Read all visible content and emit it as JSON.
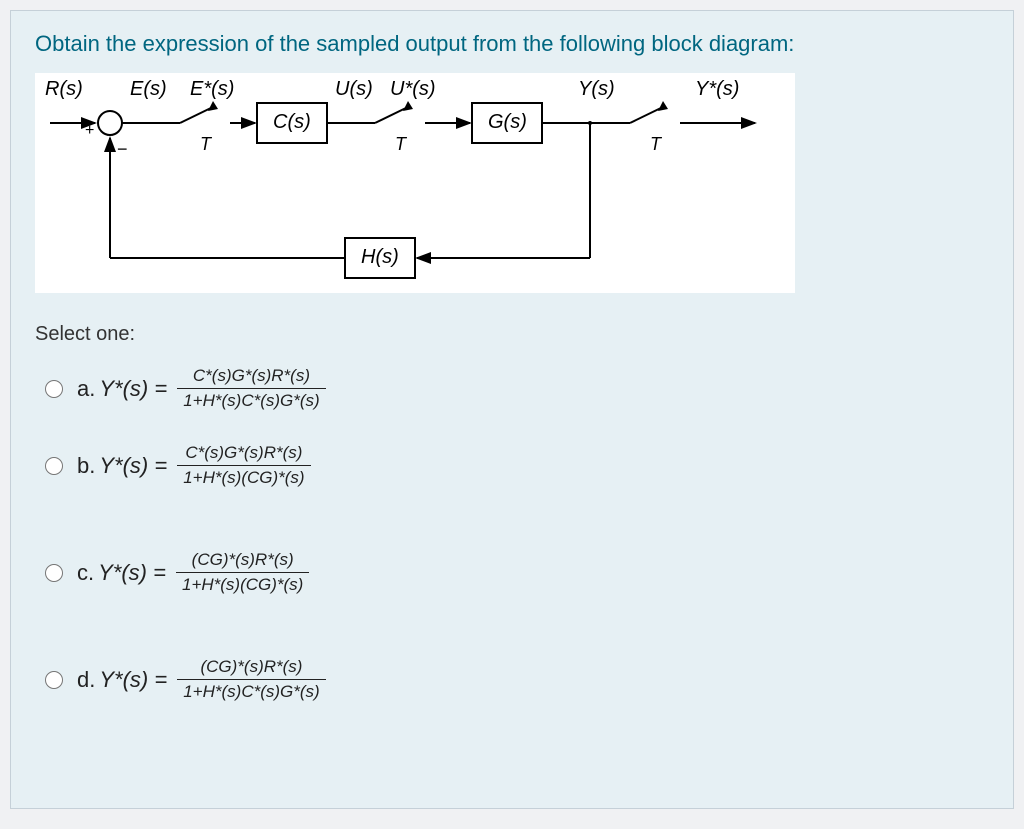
{
  "question": {
    "prompt": "Obtain the expression of the sampled output from the following block diagram:",
    "select_label": "Select one:"
  },
  "diagram": {
    "signals": {
      "R": "R(s)",
      "E": "E(s)",
      "Estar": "E*(s)",
      "U": "U(s)",
      "Ustar": "U*(s)",
      "Y": "Y(s)",
      "Ystar": "Y*(s)"
    },
    "blocks": {
      "C": "C(s)",
      "G": "G(s)",
      "H": "H(s)"
    },
    "sampler_label": "T",
    "summer": {
      "plus": "+",
      "minus": "−"
    }
  },
  "options": {
    "a": {
      "letter": "a.",
      "lhs": "Y*(s) =",
      "num": "C*(s)G*(s)R*(s)",
      "den": "1+H*(s)C*(s)G*(s)"
    },
    "b": {
      "letter": "b.",
      "lhs": "Y*(s) =",
      "num": "C*(s)G*(s)R*(s)",
      "den": "1+H*(s)(CG)*(s)"
    },
    "c": {
      "letter": "c.",
      "lhs": "Y*(s) =",
      "num": "(CG)*(s)R*(s)",
      "den": "1+H*(s)(CG)*(s)"
    },
    "d": {
      "letter": "d.",
      "lhs": "Y*(s) =",
      "num": "(CG)*(s)R*(s)",
      "den": "1+H*(s)C*(s)G*(s)"
    }
  }
}
